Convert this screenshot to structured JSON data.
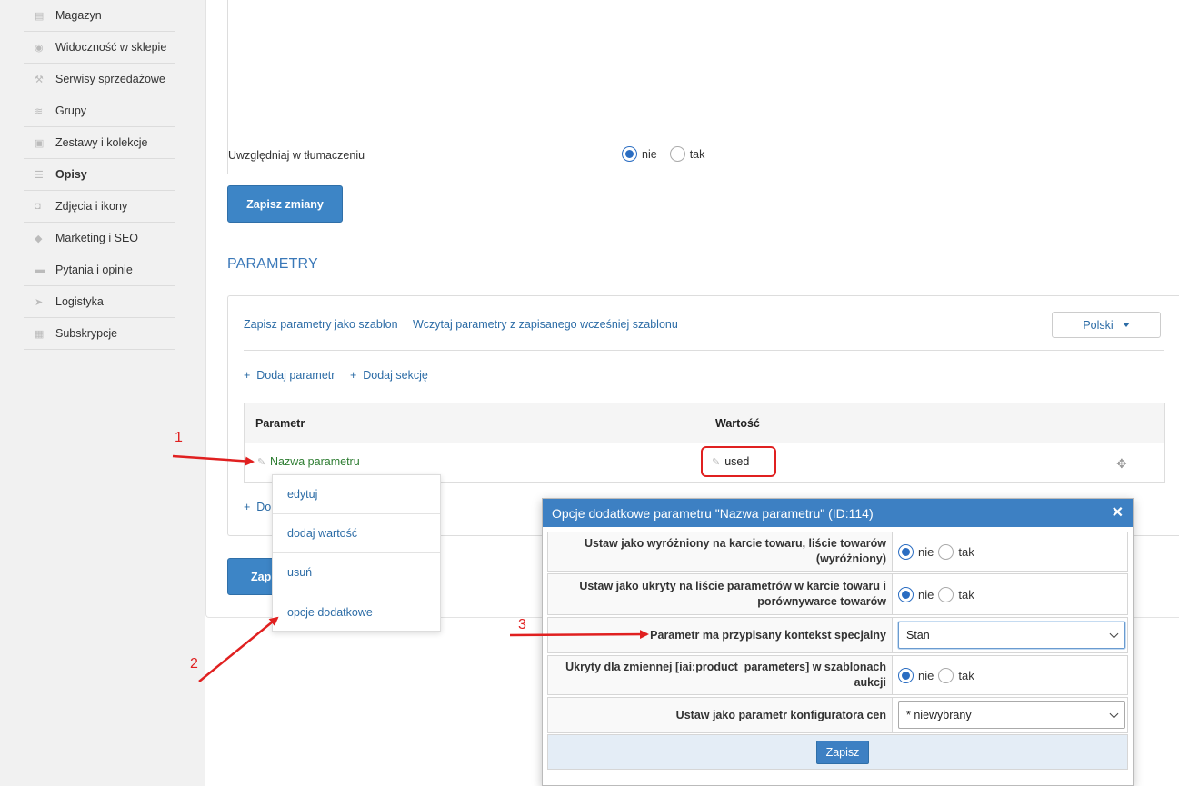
{
  "sidebar": {
    "items": [
      {
        "label": "Magazyn",
        "icon": "box-icon"
      },
      {
        "label": "Widoczność w sklepie",
        "icon": "eye-icon"
      },
      {
        "label": "Serwisy sprzedażowe",
        "icon": "hammer-icon"
      },
      {
        "label": "Grupy",
        "icon": "layers-icon"
      },
      {
        "label": "Zestawy i kolekcje",
        "icon": "collection-icon"
      },
      {
        "label": "Opisy",
        "icon": "text-lines-icon",
        "active": true
      },
      {
        "label": "Zdjęcia i ikony",
        "icon": "camera-icon"
      },
      {
        "label": "Marketing i SEO",
        "icon": "tag-icon"
      },
      {
        "label": "Pytania i opinie",
        "icon": "chat-icon"
      },
      {
        "label": "Logistyka",
        "icon": "paper-plane-icon"
      },
      {
        "label": "Subskrypcje",
        "icon": "calendar-icon"
      }
    ]
  },
  "translate": {
    "label": "Uwzględniaj w tłumaczeniu",
    "options": [
      "nie",
      "tak"
    ],
    "selected": "nie"
  },
  "save_changes_label": "Zapisz zmiany",
  "params": {
    "title": "PARAMETRY",
    "save_template": "Zapisz parametry jako szablon",
    "load_template": "Wczytaj parametry z zapisanego wcześniej szablonu",
    "language": "Polski",
    "add_param": "Dodaj parametr",
    "add_section": "Dodaj sekcję",
    "col_param": "Parametr",
    "col_value": "Wartość",
    "row": {
      "name": "Nazwa parametru",
      "value": "used"
    },
    "bottom_add_partial": "Do",
    "bottom_save_partial": "Zapi"
  },
  "context_menu": {
    "items": [
      "edytuj",
      "dodaj wartość",
      "usuń",
      "opcje dodatkowe"
    ]
  },
  "annotations": {
    "n1": "1",
    "n2": "2",
    "n3": "3",
    "color": "#e02020"
  },
  "modal": {
    "title": "Opcje dodatkowe parametru \"Nazwa parametru\" (ID:114)",
    "close": "✕",
    "rows": [
      {
        "label": "Ustaw jako wyróżniony na karcie towaru, liście towarów (wyróżniony)",
        "type": "radio",
        "options": [
          "nie",
          "tak"
        ],
        "selected": "nie"
      },
      {
        "label": "Ustaw jako ukryty na liście parametrów w karcie towaru i porównywarce towarów",
        "type": "radio",
        "options": [
          "nie",
          "tak"
        ],
        "selected": "nie"
      },
      {
        "label": "Parametr ma przypisany kontekst specjalny",
        "type": "select",
        "value": "Stan"
      },
      {
        "label": "Ukryty dla zmiennej [iai:product_parameters] w szablonach aukcji",
        "type": "radio",
        "options": [
          "nie",
          "tak"
        ],
        "selected": "nie"
      },
      {
        "label": "Ustaw jako parametr konfiguratora cen",
        "type": "select",
        "value": "* niewybrany"
      }
    ],
    "save_label": "Zapisz"
  },
  "colors": {
    "accent": "#3d85c6",
    "link": "#2c6ca6",
    "param_green": "#2e7d32",
    "annotation_red": "#e02020"
  }
}
